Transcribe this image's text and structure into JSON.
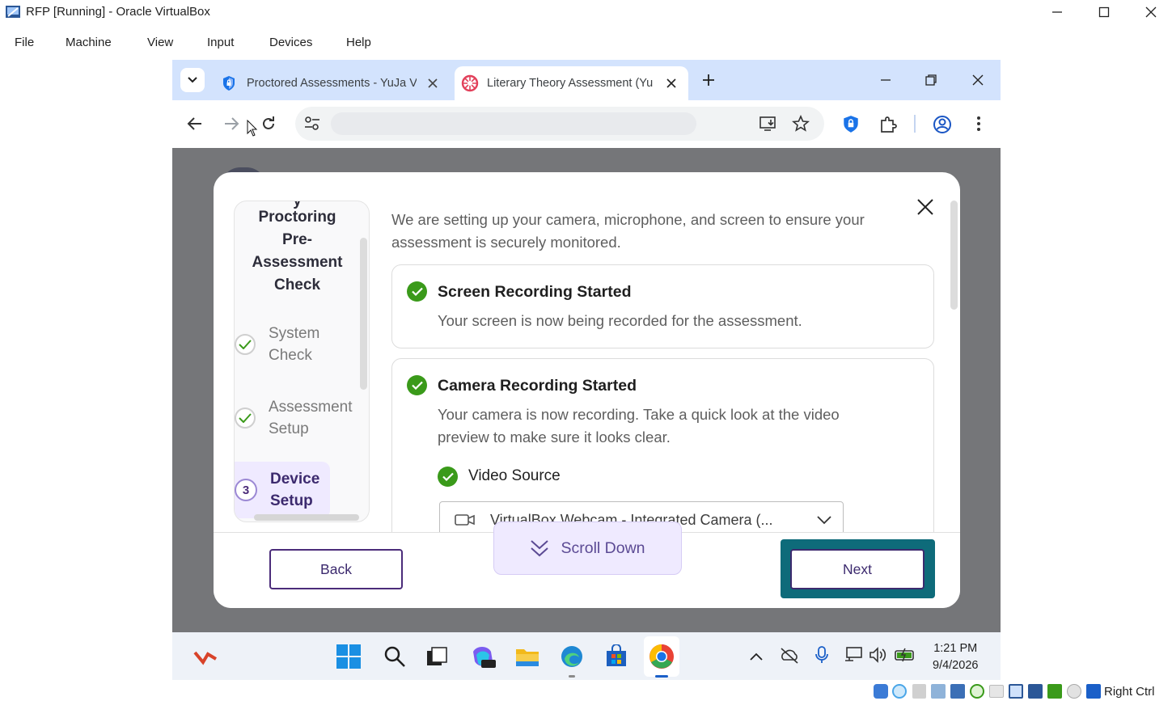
{
  "window": {
    "title": "RFP [Running] - Oracle VirtualBox"
  },
  "menu": [
    "File",
    "Machine",
    "View",
    "Input",
    "Devices",
    "Help"
  ],
  "browser": {
    "tabs": [
      {
        "label": "Proctored Assessments - YuJa V",
        "active": false
      },
      {
        "label": "Literary Theory Assessment (Yu",
        "active": true
      }
    ],
    "address_value": ""
  },
  "modal": {
    "sidebar": {
      "title": [
        "y",
        "Proctoring",
        "Pre-",
        "Assessment",
        "Check"
      ],
      "steps": [
        {
          "lines": [
            "System",
            "Check"
          ],
          "state": "done"
        },
        {
          "lines": [
            "Assessment",
            "Setup"
          ],
          "state": "done"
        },
        {
          "number": "3",
          "lines": [
            "Device",
            "Setup"
          ],
          "state": "current"
        }
      ]
    },
    "intro": "We are setting up your camera, microphone, and screen to ensure your assessment is securely monitored.",
    "cards": [
      {
        "title": "Screen Recording Started",
        "text": "Your screen is now being recorded for the assessment."
      },
      {
        "title": "Camera Recording Started",
        "text": "Your camera is now recording. Take a quick look at the video preview to make sure it looks clear."
      }
    ],
    "video_source": {
      "label": "Video Source",
      "selected": "VirtualBox Webcam - Integrated Camera (..."
    },
    "buttons": {
      "back": "Back",
      "scroll_down": "Scroll Down",
      "next": "Next"
    }
  },
  "taskbar": {
    "time": "1:21 PM",
    "date": "9/4/2026"
  },
  "status_bar": {
    "host_key": "Right Ctrl"
  },
  "colors": {
    "accent": "#4b2c7a",
    "check_green": "#3a9a1a",
    "focus_ring": "#0e6b7a",
    "tab_strip": "#d3e3fd"
  }
}
